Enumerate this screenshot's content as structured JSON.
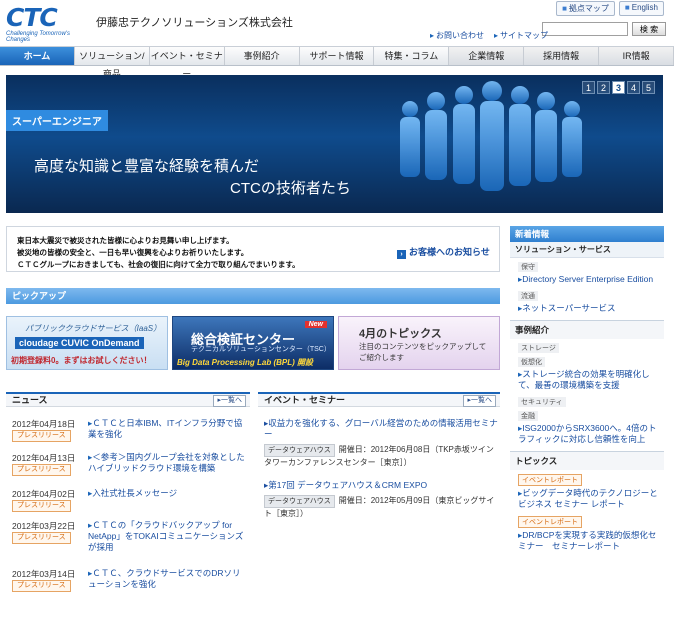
{
  "header": {
    "logo_text": "CTC",
    "logo_tagline": "Challenging Tomorrow's Changes",
    "company_name": "伊藤忠テクノソリューションズ株式会社",
    "util_links": [
      "拠点マップ",
      "English"
    ],
    "links": [
      "お問い合わせ",
      "サイトマップ"
    ],
    "search_placeholder": "",
    "search_button": "検 索"
  },
  "nav": {
    "items": [
      "ホーム",
      "ソリューション/商品",
      "イベント・セミナー",
      "事例紹介",
      "サポート情報",
      "特集・コラム",
      "企業情報",
      "採用情報",
      "IR情報"
    ]
  },
  "hero": {
    "tag": "スーパーエンジニア",
    "line1": "高度な知識と豊富な経験を積んだ",
    "line2": "CTCの技術者たち",
    "pages": [
      "1",
      "2",
      "3",
      "4",
      "5"
    ],
    "active_page": "3"
  },
  "notice": {
    "lines": [
      "東日本大震災で被災された皆様に心よりお見舞い申し上げます。",
      "被災地の皆様の安全と、一日も早い復興を心よりお祈りいたします。",
      "ＣＴＣグループにおきましても、社会の復旧に向けて全力で取り組んでまいります。"
    ],
    "link": "お客様へのお知らせ"
  },
  "pickup": {
    "title": "ピックアップ",
    "banners": [
      {
        "line1": "パブリッククラウドサービス（IaaS）",
        "line2": "cloudage CUVIC OnDemand",
        "line3": "初期登録料0。まずはお試しください！"
      },
      {
        "line1": "総合検証センター",
        "line2": "テクニカルソリューションセンター（TSC）",
        "line3": "Big Data Processing Lab (BPL) 開設",
        "badge": "New"
      },
      {
        "line1": "4月のトピックス",
        "line2": "注目のコンテンツをピックアップしてご紹介します"
      }
    ]
  },
  "news": {
    "title": "ニュース",
    "more": "一覧へ",
    "items": [
      {
        "date": "2012年04月18日",
        "badge": "プレスリリース",
        "title": "ＣＴＣと日本IBM、ITインフラ分野で協業を強化"
      },
      {
        "date": "2012年04月13日",
        "badge": "プレスリリース",
        "title": "＜参考＞国内グループ会社を対象としたハイブリッドクラウド環境を構築"
      },
      {
        "date": "2012年04月02日",
        "badge": "プレスリリース",
        "title": "入社式社長メッセージ"
      },
      {
        "date": "2012年03月22日",
        "badge": "プレスリリース",
        "title": "ＣＴＣの「クラウドバックアップ for NetApp」をTOKAIコミュニケーションズが採用"
      },
      {
        "date": "2012年03月14日",
        "badge": "プレスリリース",
        "title": "ＣＴＣ、クラウドサービスでのDRソリューションを強化"
      }
    ]
  },
  "events": {
    "title": "イベント・セミナー",
    "more": "一覧へ",
    "items": [
      {
        "title": "収益力を強化する、グローバル経営のための情報活用セミナー",
        "cat": "データウェアハウス",
        "meta": "開催日：2012年06月08日（TKP赤坂ツインタワーカンファレンスセンター［東京］）"
      },
      {
        "title": "第17回 データウェアハウス＆CRM EXPO",
        "cat": "データウェアハウス",
        "meta": "開催日：2012年05月09日（東京ビッグサイト［東京］）"
      }
    ]
  },
  "sidebar": {
    "new_head": "新着情報",
    "solution_head": "ソリューション・サービス",
    "sol_groups": [
      {
        "tag": "保守",
        "link": "Directory Server Enterprise Edition"
      },
      {
        "tag": "流通",
        "link": "ネットスーパーサービス"
      }
    ],
    "case_head": "事例紹介",
    "case_groups": [
      {
        "tags": [
          "ストレージ",
          "仮想化"
        ],
        "link": "ストレージ統合の効果を明確化して、最善の環境構築を支援"
      },
      {
        "tags": [
          "セキュリティ",
          "金融"
        ],
        "link": "ISG2000からSRX3600へ。4倍のトラフィックに対応し信頼性を向上"
      }
    ],
    "topics_head": "トピックス",
    "topics": [
      {
        "badge": "イベントレポート",
        "link": "ビッグデータ時代のテクノロジーとビジネス セミナー レポート"
      },
      {
        "badge": "イベントレポート",
        "link": "DR/BCPを実現する実践的仮想化セミナー　セミナーレポート"
      }
    ]
  }
}
